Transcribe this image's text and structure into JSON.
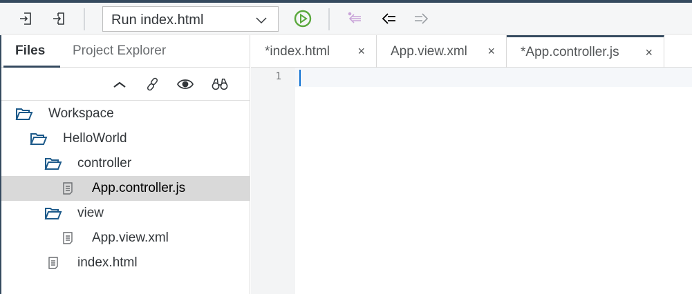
{
  "toolbar": {
    "run_config": "Run index.html"
  },
  "left_panel": {
    "tabs": [
      {
        "label": "Files"
      },
      {
        "label": "Project Explorer"
      }
    ],
    "tree": [
      {
        "label": "Workspace",
        "type": "folder",
        "level": 0
      },
      {
        "label": "HelloWorld",
        "type": "folder",
        "level": 1
      },
      {
        "label": "controller",
        "type": "folder",
        "level": 2
      },
      {
        "label": "App.controller.js",
        "type": "file",
        "level": 3,
        "selected": true
      },
      {
        "label": "view",
        "type": "folder",
        "level": 2
      },
      {
        "label": "App.view.xml",
        "type": "file",
        "level": 3
      },
      {
        "label": "index.html",
        "type": "file",
        "level": 2
      }
    ]
  },
  "editor": {
    "tabs": [
      {
        "label": "*index.html",
        "close": "×"
      },
      {
        "label": "App.view.xml",
        "close": "×"
      },
      {
        "label": "*App.controller.js",
        "close": "×",
        "active": true
      }
    ],
    "line_numbers": [
      "1"
    ]
  },
  "colors": {
    "accent": "#354a5f",
    "run": "#5aa83c",
    "cursor": "#0a6ed1"
  }
}
